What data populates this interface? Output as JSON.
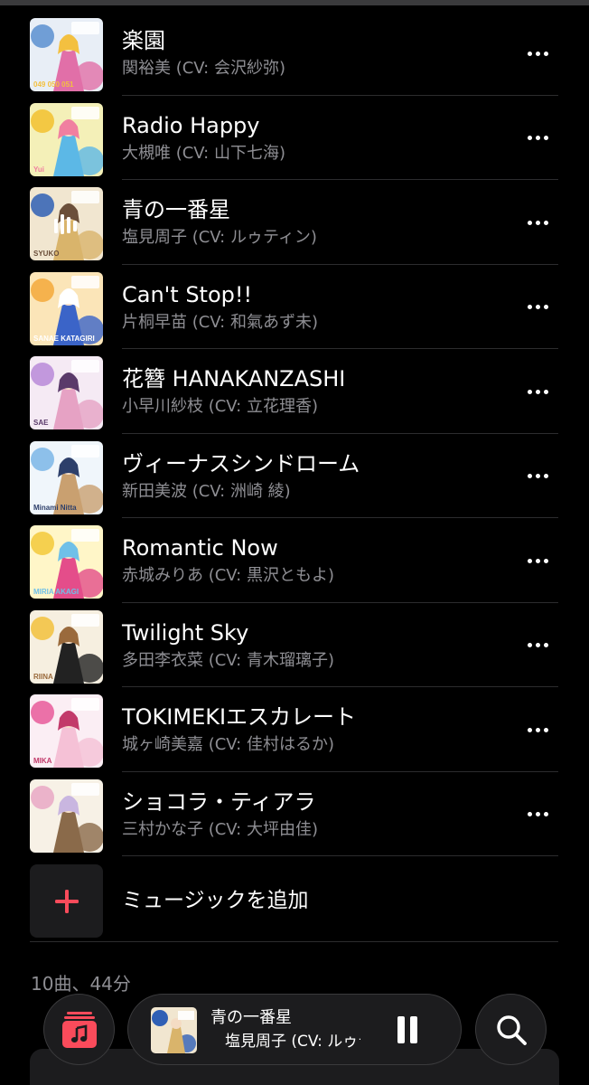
{
  "tracks": [
    {
      "title": "楽園",
      "artist": "関裕美 (CV: 会沢紗弥)",
      "art_colors": [
        "#e8eef6",
        "#5a8fd0",
        "#e16fa8",
        "#f3c040"
      ],
      "art_label": "049 050 051"
    },
    {
      "title": "Radio Happy",
      "artist": "大槻唯 (CV: 山下七海)",
      "art_colors": [
        "#f4f0b8",
        "#f2c12e",
        "#5cb8e6",
        "#f07fa0"
      ],
      "art_label": "Yui"
    },
    {
      "title": "青の一番星",
      "artist": "塩見周子 (CV: ルゥティン)",
      "art_colors": [
        "#f1e6d0",
        "#2f5fb5",
        "#d9b46b",
        "#6b4f3a"
      ],
      "art_label": "SYUKO",
      "now_playing": true
    },
    {
      "title": "Can't Stop!!",
      "artist": "片桐早苗 (CV: 和氣あず未)",
      "art_colors": [
        "#fbe5b8",
        "#f3a93a",
        "#3b64c8",
        "#ffffff"
      ],
      "art_label": "SANAE KATAGIRI"
    },
    {
      "title": "花簪 HANAKANZASHI",
      "artist": "小早川紗枝 (CV: 立花理香)",
      "art_colors": [
        "#f5eaf4",
        "#b98ad8",
        "#e6a2c4",
        "#5a3a6a"
      ],
      "art_label": "SAE"
    },
    {
      "title": "ヴィーナスシンドローム",
      "artist": "新田美波 (CV: 洲崎 綾)",
      "art_colors": [
        "#f0f6fb",
        "#7bb6e6",
        "#c9a070",
        "#2d3f6a"
      ],
      "art_label": "Minami Nitta"
    },
    {
      "title": "Romantic Now",
      "artist": "赤城みりあ (CV: 黒沢ともよ)",
      "art_colors": [
        "#fff6c8",
        "#f3c93a",
        "#e44d8a",
        "#6fc0e8"
      ],
      "art_label": "MIRIA AKAGI"
    },
    {
      "title": "Twilight Sky",
      "artist": "多田李衣菜 (CV: 青木瑠璃子)",
      "art_colors": [
        "#f6efe0",
        "#f2c13c",
        "#222222",
        "#9a6a3c"
      ],
      "art_label": "RIINA"
    },
    {
      "title": "TOKIMEKIエスカレート",
      "artist": "城ヶ崎美嘉 (CV: 佳村はるか)",
      "art_colors": [
        "#fbeef4",
        "#e85a9a",
        "#f5c1d6",
        "#c23a6a"
      ],
      "art_label": "MIKA"
    },
    {
      "title": "ショコラ・ティアラ",
      "artist": "三村かな子 (CV: 大坪由佳)",
      "art_colors": [
        "#f7f1e6",
        "#e9a8c4",
        "#8a6a4a",
        "#c9b6e0"
      ],
      "art_label": ""
    }
  ],
  "add_music": {
    "label": "ミュージックを追加",
    "icon": "plus-icon",
    "accent": "#fa4b5b"
  },
  "summary": "10曲、44分",
  "mini_player": {
    "title": "青の一番星",
    "artist": "塩見周子 (CV: ルゥティン)",
    "state_icon": "pause-icon"
  },
  "buttons": {
    "library_icon": "music-library-icon",
    "search_icon": "search-icon"
  },
  "colors": {
    "accent": "#fa4b5b",
    "secondary_text": "#8e8e93",
    "background": "#000000",
    "surface": "#1c1c1e"
  }
}
